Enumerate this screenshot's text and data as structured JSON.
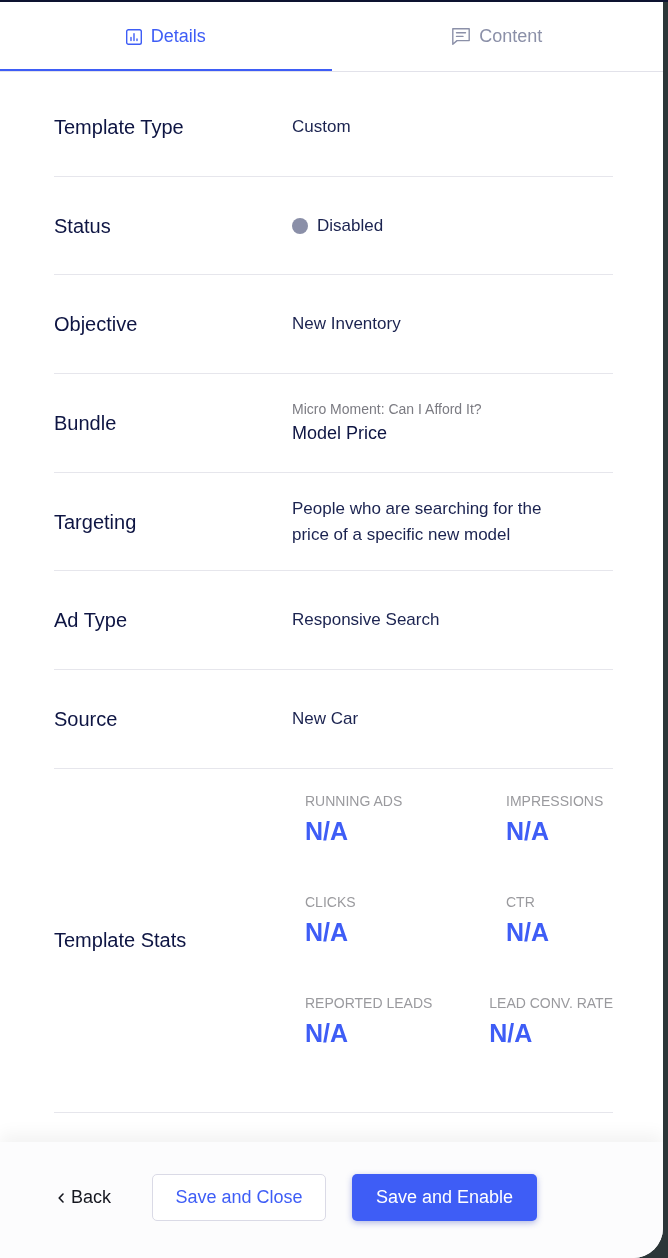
{
  "tabs": [
    {
      "label": "Details",
      "selected": true
    },
    {
      "label": "Content",
      "selected": false
    }
  ],
  "rows": [
    {
      "kind": "text",
      "label": "Template Type",
      "value": "Custom"
    },
    {
      "kind": "status",
      "label": "Status",
      "value": "Disabled",
      "color": "#8a8fa8"
    },
    {
      "kind": "text",
      "label": "Objective",
      "value": "New Inventory"
    },
    {
      "kind": "bundle",
      "label": "Bundle",
      "caption": "Micro Moment: Can I Afford It?",
      "value": "Model Price"
    },
    {
      "kind": "text",
      "label": "Targeting",
      "value": "People who are searching for the price of a specific new model"
    },
    {
      "kind": "text",
      "label": "Ad Type",
      "value": "Responsive Search"
    },
    {
      "kind": "text",
      "label": "Source",
      "value": "New Car"
    },
    {
      "kind": "stats",
      "label": "Template Stats",
      "stat_rows": [
        [
          {
            "label": "RUNNING ADS",
            "value": "N/A"
          },
          {
            "label": "IMPRESSIONS",
            "value": "N/A"
          }
        ],
        [
          {
            "label": "CLICKS",
            "value": "N/A"
          },
          {
            "label": "CTR",
            "value": "N/A"
          }
        ],
        [
          {
            "label": "REPORTED LEADS",
            "value": "N/A"
          },
          {
            "label": "LEAD CONV. RATE",
            "value": "N/A"
          }
        ]
      ]
    }
  ],
  "footer": {
    "back": "Back",
    "buttons": [
      {
        "kind": "secondary",
        "label": "Save and Close"
      },
      {
        "kind": "primary",
        "label": "Save and Enable"
      }
    ]
  }
}
